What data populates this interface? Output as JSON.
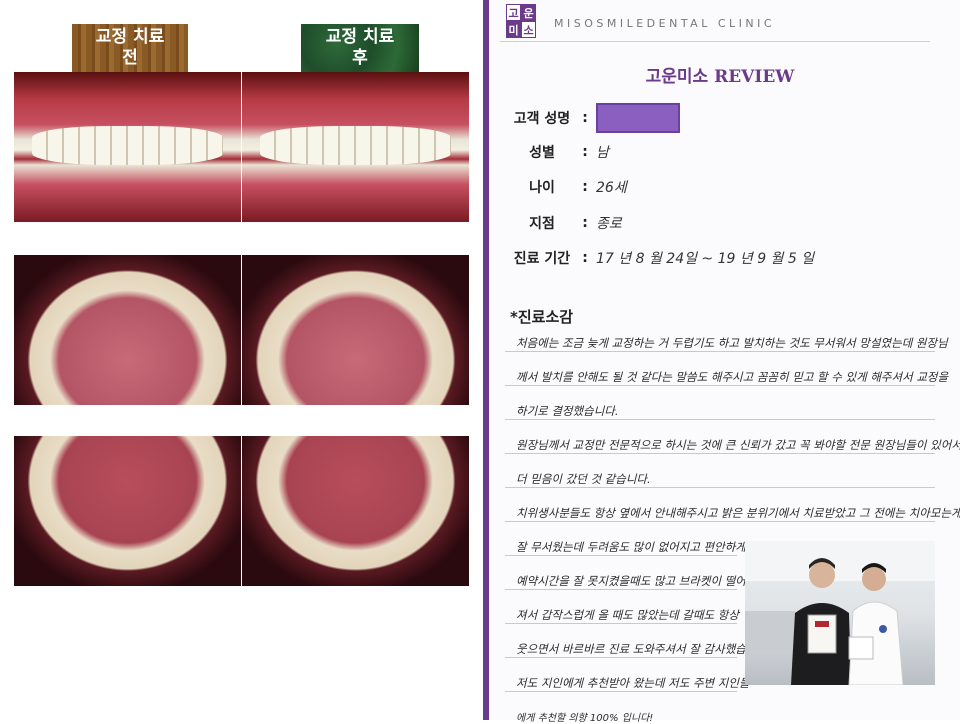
{
  "collage": {
    "label_before": "교정 치료\n전",
    "label_after": "교정 치료\n후"
  },
  "form": {
    "logo": [
      "고",
      "운",
      "미",
      "소"
    ],
    "clinic_name": "MISOSMILEDENTAL CLINIC",
    "title": "고운미소 REVIEW",
    "fields": [
      {
        "label": "고객 성명",
        "value": ""
      },
      {
        "label": "성별",
        "value": "남"
      },
      {
        "label": "나이",
        "value": "26세"
      },
      {
        "label": "지점",
        "value": "종로"
      },
      {
        "label": "진료 기간",
        "value": "17 년  8 월  24일   ~  19 년  9 월  5 일"
      }
    ],
    "section_title": "*진료소감",
    "handwriting": [
      "처음에는 조금 늦게 교정하는 거 두렵기도 하고 발치하는 것도 무서워서 망설였는데 원장님",
      "께서 발치를 안해도 될 것 같다는 말씀도 해주시고 꼼꼼히 믿고 할 수 있게 해주셔서 교정을",
      "하기로 결정했습니다.",
      "원장님께서 교정만 전문적으로 하시는 것에 큰 신뢰가 갔고 꼭 봐야할 전문 원장님들이 있어서",
      "더 믿음이 갔던 것 같습니다.",
      "치위생사분들도 항상 옆에서 안내해주시고 밝은 분위기에서 치료받았고 그 전에는 치아모는게",
      "잘 무서웠는데 두려움도 많이 없어지고 편안하게 올 수 있었던 것 같습니다!",
      "예약시간을 잘 못지켰을때도 많고 브라켓이 떨어",
      "져서 갑작스럽게 올 때도 많았는데 갈때도 항상",
      "웃으면서 바르바르 진료 도와주셔서 잘 감사했습니다!",
      "저도 지인에게 추천받아 왔는데 저도 주변 지인들",
      "에게 추천할 의향 100% 입니다!"
    ]
  }
}
